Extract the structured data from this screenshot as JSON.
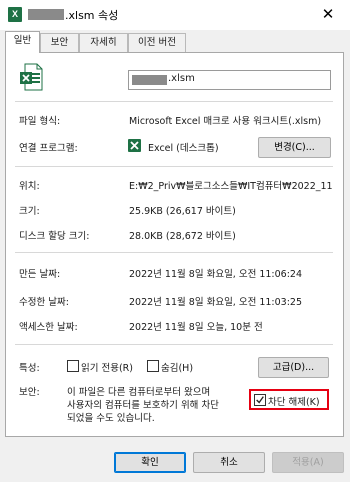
{
  "window": {
    "title_suffix": ".xlsm 속성",
    "app_icon_glyph": "X",
    "close_glyph": "✕"
  },
  "tabs": [
    {
      "label": "일반",
      "active": true
    },
    {
      "label": "보안",
      "active": false
    },
    {
      "label": "자세히",
      "active": false
    },
    {
      "label": "이전 버전",
      "active": false
    }
  ],
  "general": {
    "file_name_suffix": ".xlsm",
    "file_type_label": "파일 형식:",
    "file_type_value": "Microsoft Excel 매크로 사용 워크시트(.xlsm)",
    "opens_with_label": "연결 프로그램:",
    "opens_with_value": "Excel (데스크톱)",
    "change_button": "변경(C)...",
    "location_label": "위치:",
    "location_value": "E:₩2_Priv₩블로그소스들₩IT컴퓨터₩2022_11",
    "size_label": "크기:",
    "size_value": "25.9KB (26,617 바이트)",
    "size_on_disk_label": "디스크 할당 크기:",
    "size_on_disk_value": "28.0KB (28,672 바이트)",
    "created_label": "만든 날짜:",
    "created_value": "2022년 11월 8일 화요일, 오전 11:06:24",
    "modified_label": "수정한 날짜:",
    "modified_value": "2022년 11월 8일 화요일, 오전 11:03:25",
    "accessed_label": "액세스한 날짜:",
    "accessed_value": "2022년 11월 8일 오늘, 10분 전",
    "attributes_label": "특성:",
    "readonly_label": "읽기 전용(R)",
    "readonly_checked": false,
    "hidden_label": "숨김(H)",
    "hidden_checked": false,
    "advanced_button": "고급(D)...",
    "security_label": "보안:",
    "security_line1": "이 파일은 다른 컴퓨터로부터 왔으며",
    "security_line2": "사용자의 컴퓨터를 보호하기 위해 차단",
    "security_line3": "되었을 수도 있습니다.",
    "unblock_label": "차단 해제(K)",
    "unblock_checked": true
  },
  "footer": {
    "ok": "확인",
    "cancel": "취소",
    "apply": "적용(A)"
  },
  "colors": {
    "excel_green": "#1e7145",
    "highlight_red": "#e60012",
    "focus_blue": "#0078d7"
  }
}
